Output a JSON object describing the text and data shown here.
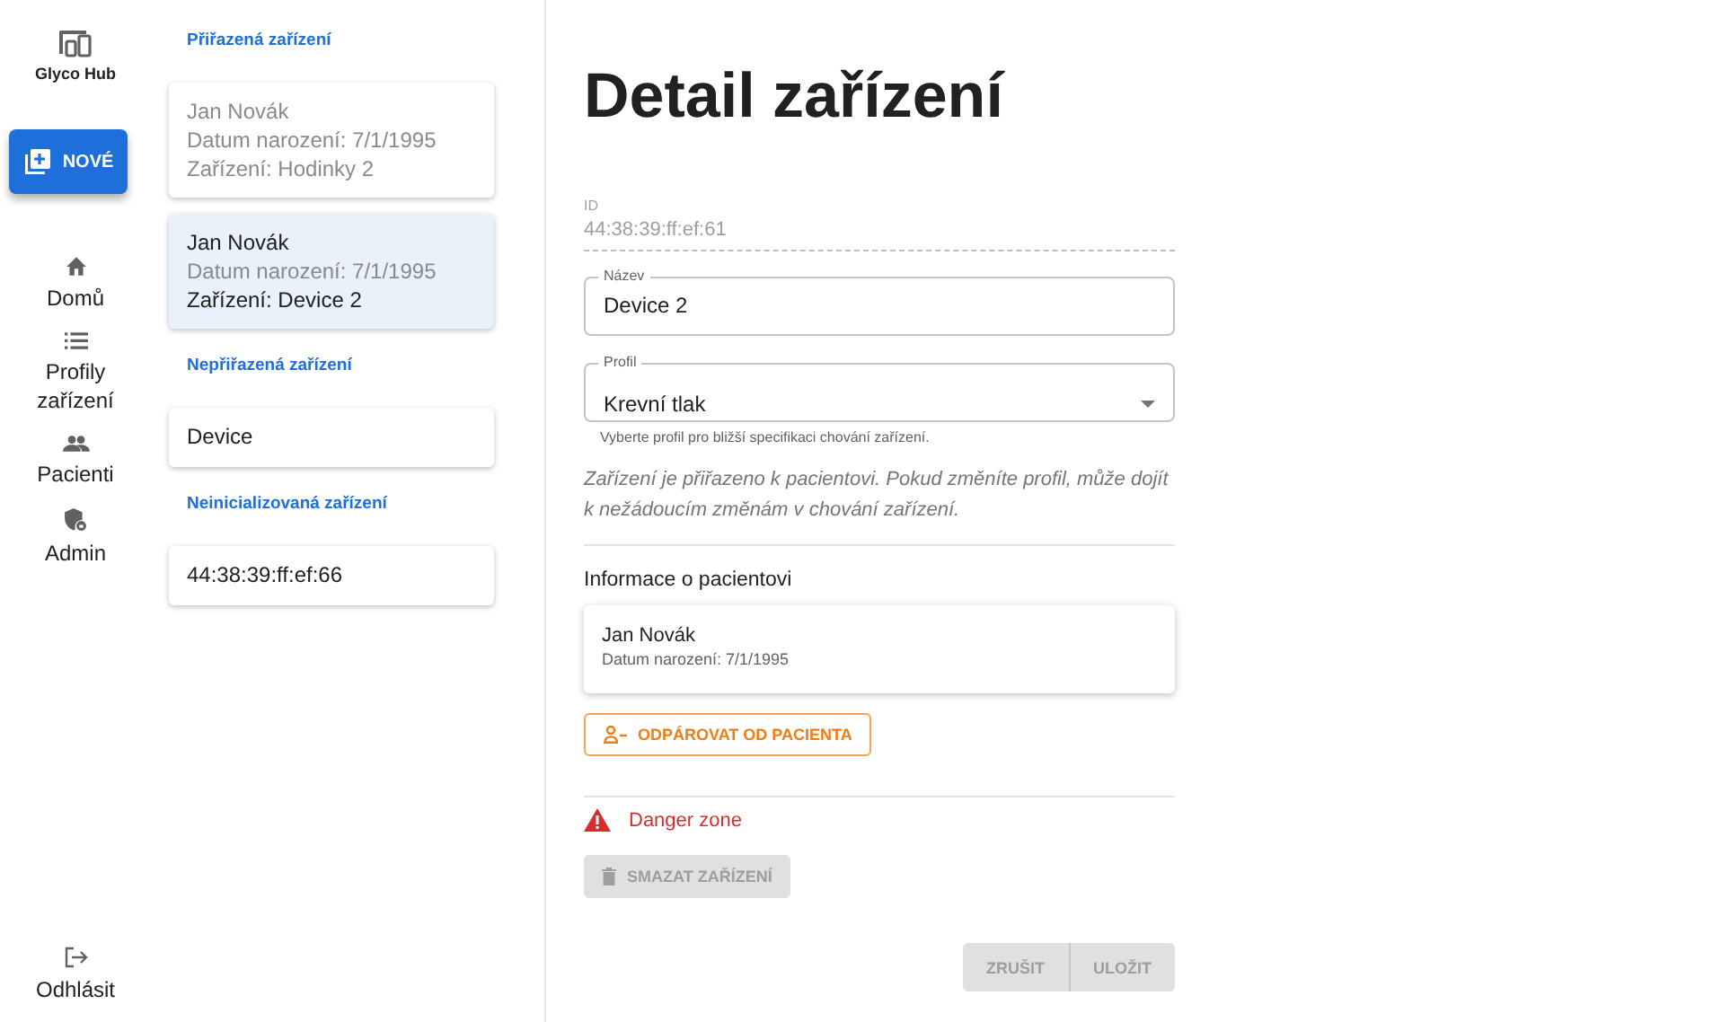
{
  "app": {
    "name": "Glyco Hub"
  },
  "new_button": {
    "label": "NOVÉ"
  },
  "nav": [
    {
      "kind": "home",
      "label": "Domů"
    },
    {
      "kind": "list",
      "label": "Profily zařízení"
    },
    {
      "kind": "people",
      "label": "Pacienti"
    },
    {
      "kind": "admin",
      "label": "Admin"
    }
  ],
  "logout": {
    "label": "Odhlásit"
  },
  "device_groups": [
    {
      "title": "Přiřazená zařízení",
      "items": [
        {
          "lines": [
            "Jan Novák",
            "Datum narození: 7/1/1995",
            "Zařízení: Hodinky 2"
          ],
          "selected": false,
          "disabled": true
        },
        {
          "lines": [
            "Jan Novák",
            "Datum narození: 7/1/1995",
            "Zařízení: Device 2"
          ],
          "selected": true,
          "disabled": false
        }
      ]
    },
    {
      "title": "Nepřiřazená zařízení",
      "items": [
        {
          "lines": [
            "Device"
          ],
          "selected": false,
          "disabled": false
        }
      ]
    },
    {
      "title": "Neinicializovaná zařízení",
      "items": [
        {
          "lines": [
            "44:38:39:ff:ef:66"
          ],
          "selected": false,
          "disabled": false
        }
      ]
    }
  ],
  "detail": {
    "title": "Detail zařízení",
    "id_field": {
      "label": "ID",
      "value": "44:38:39:ff:ef:61"
    },
    "name_field": {
      "label": "Název",
      "value": "Device 2"
    },
    "profile_field": {
      "label": "Profil",
      "value": "Krevní tlak",
      "helper": "Vyberte profil pro bližší specifikaci chování zařízení."
    },
    "warning": "Zařízení je přiřazeno k pacientovi. Pokud změníte profil, může dojít k nežádoucím změnám v chování zařízení.",
    "patient_heading": "Informace o pacientovi",
    "patient": {
      "name": "Jan Novák",
      "birth": "Datum narození: 7/1/1995"
    },
    "unpair_button": {
      "label": "ODPÁROVAT OD PACIENTA",
      "disabled": false
    },
    "danger_title": "Danger zone",
    "delete_button": {
      "label": "SMAZAT ZAŘÍZENÍ",
      "disabled": true
    },
    "actions": [
      {
        "label": "ZRUŠIT",
        "disabled": true
      },
      {
        "label": "ULOŽIT",
        "disabled": true
      }
    ]
  }
}
